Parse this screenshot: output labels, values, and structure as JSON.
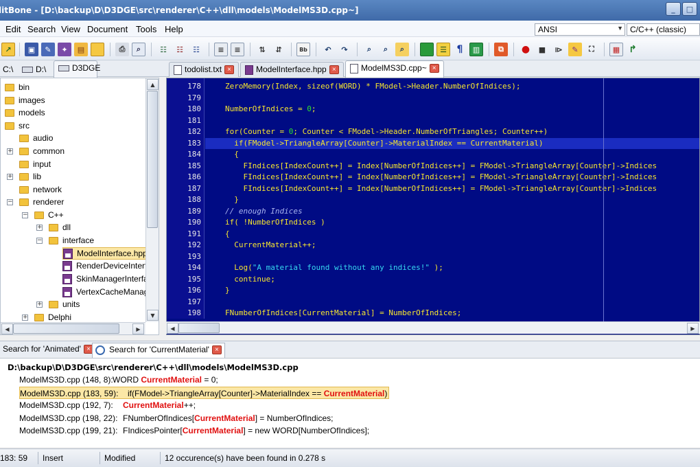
{
  "window": {
    "title": "litBone - [D:\\backup\\D\\D3DGE\\src\\renderer\\C++\\dll\\models\\ModelMS3D.cpp~]"
  },
  "menu": [
    "Edit",
    "Search",
    "View",
    "Document",
    "Tools",
    "Help"
  ],
  "toolbar_combos": {
    "encoding": "ANSI",
    "language": "C/C++ (classic)"
  },
  "drive_tabs": [
    {
      "label": "C:\\"
    },
    {
      "label": "D:\\"
    },
    {
      "label": "D3DGE"
    }
  ],
  "file_tabs": [
    {
      "label": "todolist.txt"
    },
    {
      "label": "ModelInterface.hpp"
    },
    {
      "label": "ModelMS3D.cpp~"
    }
  ],
  "tree": {
    "items": [
      {
        "label": "bin"
      },
      {
        "label": "images"
      },
      {
        "label": "models"
      },
      {
        "label": "src"
      },
      {
        "label": "audio"
      },
      {
        "label": "common"
      },
      {
        "label": "input"
      },
      {
        "label": "lib"
      },
      {
        "label": "network"
      },
      {
        "label": "renderer"
      },
      {
        "label": "C++"
      },
      {
        "label": "dll"
      },
      {
        "label": "interface"
      },
      {
        "label": "ModelInterface.hpp"
      },
      {
        "label": "RenderDeviceInterf"
      },
      {
        "label": "SkinManagerInterfa"
      },
      {
        "label": "VertexCacheManag"
      },
      {
        "label": "units"
      },
      {
        "label": "Delphi"
      }
    ]
  },
  "editor": {
    "lines": [
      {
        "n": "178",
        "t": "ZeroMemory(Index, sizeof(WORD) * FModel->Header.NumberOfIndices);"
      },
      {
        "n": "179",
        "t": ""
      },
      {
        "n": "180",
        "t": "NumberOfIndices = 0;"
      },
      {
        "n": "181",
        "t": ""
      },
      {
        "n": "182",
        "t": "for(Counter = 0; Counter < FModel->Header.NumberOfTriangles; Counter++)"
      },
      {
        "n": "183",
        "t": "  if(FModel->TriangleArray[Counter]->MaterialIndex == CurrentMaterial)"
      },
      {
        "n": "184",
        "t": "  {"
      },
      {
        "n": "185",
        "t": "    FIndices[IndexCount++] = Index[NumberOfIndices++] = FModel->TriangleArray[Counter]->Indices"
      },
      {
        "n": "186",
        "t": "    FIndices[IndexCount++] = Index[NumberOfIndices++] = FModel->TriangleArray[Counter]->Indices"
      },
      {
        "n": "187",
        "t": "    FIndices[IndexCount++] = Index[NumberOfIndices++] = FModel->TriangleArray[Counter]->Indices"
      },
      {
        "n": "188",
        "t": "  }"
      },
      {
        "n": "189",
        "t": "// enough Indices"
      },
      {
        "n": "190",
        "t": "if( !NumberOfIndices )"
      },
      {
        "n": "191",
        "t": "{"
      },
      {
        "n": "192",
        "t": "  CurrentMaterial++;"
      },
      {
        "n": "193",
        "t": ""
      },
      {
        "n": "194",
        "t": "  Log(\"A material found without any indices!\" );"
      },
      {
        "n": "195",
        "t": "  continue;"
      },
      {
        "n": "196",
        "t": "}"
      },
      {
        "n": "197",
        "t": ""
      },
      {
        "n": "198",
        "t": "FNumberOfIndices[CurrentMaterial] = NumberOfIndices;"
      }
    ],
    "colors": {
      "background": "#000b84",
      "text": "#f7e62f",
      "number": "#2ce02c",
      "string": "#36d8f0",
      "highlight": "#1a2cc0"
    }
  },
  "search_tabs": [
    {
      "label": "Search for 'Animated'"
    },
    {
      "label": "Search for 'CurrentMaterial'"
    }
  ],
  "results": {
    "path": "D:\\backup\\D\\D3DGE\\src\\renderer\\C++\\dll\\models\\ModelMS3D.cpp",
    "items": [
      {
        "loc": "ModelMS3D.cpp (148, 8):",
        "pre": "WORD ",
        "match": "CurrentMaterial",
        "post": " = 0;"
      },
      {
        "loc": "ModelMS3D.cpp (183, 59):",
        "pre": "if(FModel->TriangleArray[Counter]->MaterialIndex == ",
        "match": "CurrentMaterial",
        "post": ")"
      },
      {
        "loc": "ModelMS3D.cpp (192, 7):",
        "pre": "",
        "match": "CurrentMaterial",
        "post": "++;"
      },
      {
        "loc": "ModelMS3D.cpp (198, 22):",
        "pre": "FNumberOfIndices[",
        "match": "CurrentMaterial",
        "post": "] = NumberOfIndices;"
      },
      {
        "loc": "ModelMS3D.cpp (199, 21):",
        "pre": "FIndicesPointer[",
        "match": "CurrentMaterial",
        "post": "] = new WORD[NumberOfIndices];"
      }
    ]
  },
  "status": {
    "position": "183: 59",
    "mode": "Insert",
    "modified": "Modified",
    "message": "12 occurence(s) have been found in 0.278 s"
  }
}
